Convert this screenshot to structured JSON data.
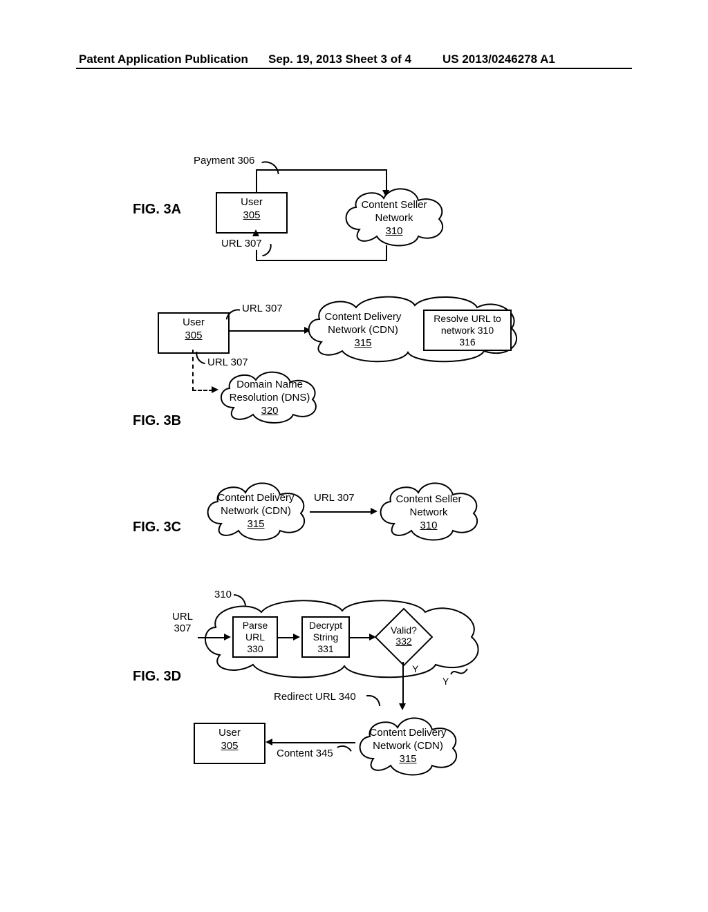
{
  "header": {
    "left": "Patent Application Publication",
    "date": "Sep. 19, 2013  Sheet 3 of 4",
    "right": "US 2013/0246278 A1"
  },
  "fig3a": {
    "label": "FIG. 3A",
    "user": "User",
    "user_ref": "305",
    "payment": "Payment 306",
    "url": "URL 307",
    "seller1": "Content Seller",
    "seller2": "Network",
    "seller_ref": "310"
  },
  "fig3b": {
    "label": "FIG. 3B",
    "user": "User",
    "user_ref": "305",
    "url1": "URL 307",
    "url2": "URL 307",
    "cdn1": "Content Delivery",
    "cdn2": "Network (CDN)",
    "cdn_ref": "315",
    "resolve1": "Resolve URL to",
    "resolve2": "network 310",
    "resolve_ref": "316",
    "dns1": "Domain Name",
    "dns2": "Resolution (DNS)",
    "dns_ref": "320"
  },
  "fig3c": {
    "label": "FIG. 3C",
    "cdn1": "Content Delivery",
    "cdn2": "Network (CDN)",
    "cdn_ref": "315",
    "url": "URL 307",
    "seller1": "Content Seller",
    "seller2": "Network",
    "seller_ref": "310"
  },
  "fig3d": {
    "label": "FIG. 3D",
    "ref310": "310",
    "url_in1": "URL",
    "url_in2": "307",
    "parse1": "Parse",
    "parse2": "URL",
    "parse_ref": "330",
    "decrypt1": "Decrypt",
    "decrypt2": "String",
    "decrypt_ref": "331",
    "valid": "Valid?",
    "valid_ref": "332",
    "y1": "Y",
    "y2": "Y",
    "redirect": "Redirect URL 340",
    "user": "User",
    "user_ref": "305",
    "content": "Content 345",
    "cdn1": "Content Delivery",
    "cdn2": "Network (CDN)",
    "cdn_ref": "315"
  }
}
